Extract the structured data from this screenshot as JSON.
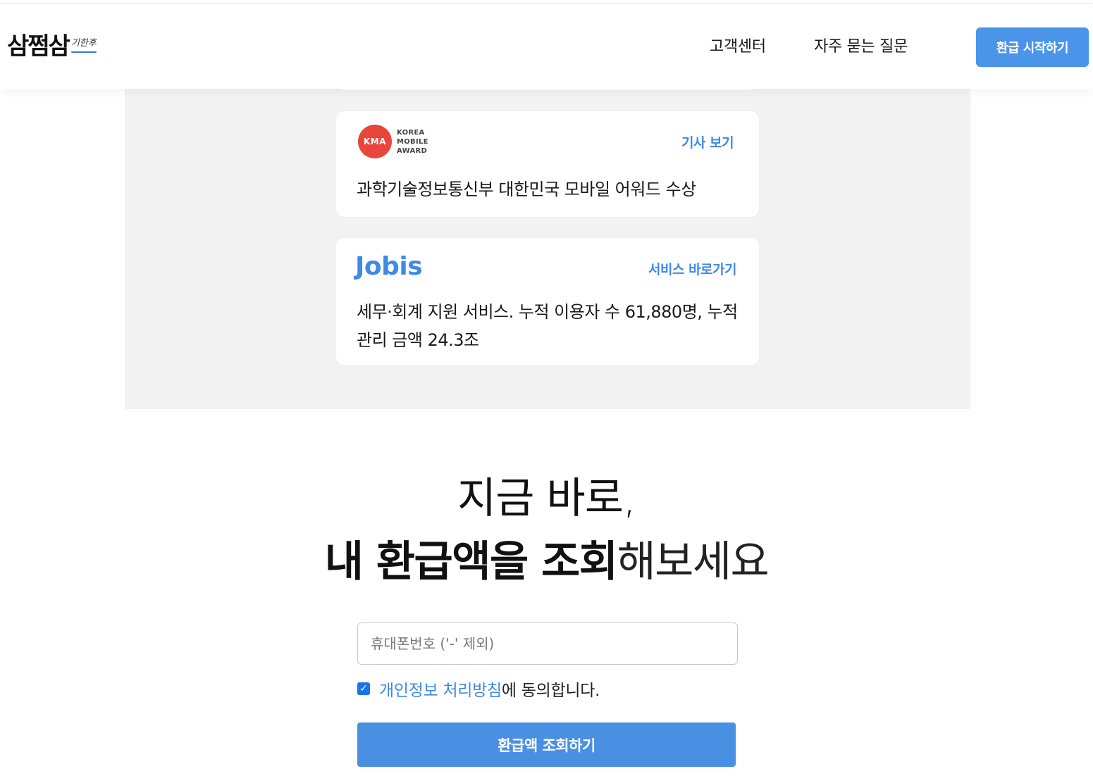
{
  "header": {
    "logo_main": "삼쩜삼",
    "logo_sub": "기한후",
    "nav": [
      {
        "label": "고객센터"
      },
      {
        "label": "자주 묻는 질문"
      }
    ],
    "start_button": "환급 시작하기"
  },
  "cards": {
    "kma": {
      "logo_mark": "KMA",
      "logo_lines": [
        "KOREA",
        "MOBILE",
        "AWARD"
      ],
      "link": "기사 보기",
      "description": "과학기술정보통신부 대한민국 모바일 어워드 수상"
    },
    "jobis": {
      "logo": "Jobis",
      "link": "서비스 바로가기",
      "description": "세무·회계 지원 서비스. 누적 이용자 수 61,880명, 누적 관리 금액 24.3조"
    }
  },
  "cta": {
    "line1": "지금 바로,",
    "line2_bold": "내 환급액을 조회",
    "line2_light": "해보세요"
  },
  "form": {
    "phone_placeholder": "휴대폰번호 ('-' 제외)",
    "phone_value": "",
    "agree_checked": true,
    "policy_link": "개인정보 처리방침",
    "agree_text": "에 동의합니다.",
    "submit_label": "환급액 조회하기"
  },
  "colors": {
    "accent": "#4a94ea",
    "link": "#3d8ae6",
    "kma_red": "#e8453c",
    "section_gray": "#f2f2f2"
  }
}
